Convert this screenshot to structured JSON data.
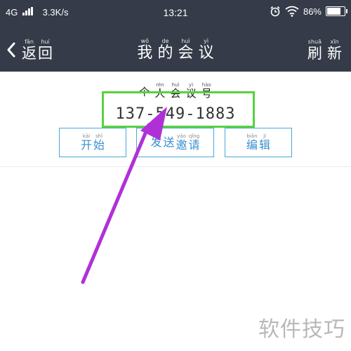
{
  "status_bar": {
    "network": "4G",
    "signal_icon": "signal-bars-icon",
    "data_rate": "3.3K/s",
    "time": "13:21",
    "alarm_icon": "alarm-clock-icon",
    "wifi_icon": "wifi-icon",
    "battery_percent": "86%",
    "battery_level": 0.86
  },
  "nav": {
    "back_icon": "chevron-left-icon",
    "back": {
      "chars": [
        "返",
        "回"
      ],
      "pinyin": [
        "fǎn",
        "huí"
      ]
    },
    "title": {
      "chars": [
        "我",
        "的",
        "会",
        "议"
      ],
      "pinyin": [
        "wǒ",
        "de",
        "huì",
        "yì"
      ]
    },
    "refresh": {
      "chars": [
        "刷",
        "新"
      ],
      "pinyin": [
        "shuā",
        "xīn"
      ]
    },
    "bg_color": "#353b48"
  },
  "meeting": {
    "label": {
      "chars": [
        "个",
        "人",
        "会",
        "议",
        "号"
      ],
      "pinyin": [
        "",
        "rén",
        "huì",
        "yì",
        "hào"
      ]
    },
    "id": "137-549-1883"
  },
  "buttons": {
    "start": {
      "chars": [
        "开",
        "始"
      ],
      "pinyin": [
        "kāi",
        "shǐ"
      ]
    },
    "invite": {
      "chars": [
        "发",
        "送",
        "邀",
        "请"
      ],
      "pinyin": [
        "",
        "",
        "yāo",
        "qǐng"
      ]
    },
    "edit": {
      "chars": [
        "编",
        "辑"
      ],
      "pinyin": [
        "biān",
        "jí"
      ]
    },
    "border_color": "#4aa8d8",
    "text_color": "#3a8fd0"
  },
  "annotation": {
    "highlight_color": "#57d23e",
    "arrow_color": "#b030d8"
  },
  "watermark": "软件技巧"
}
